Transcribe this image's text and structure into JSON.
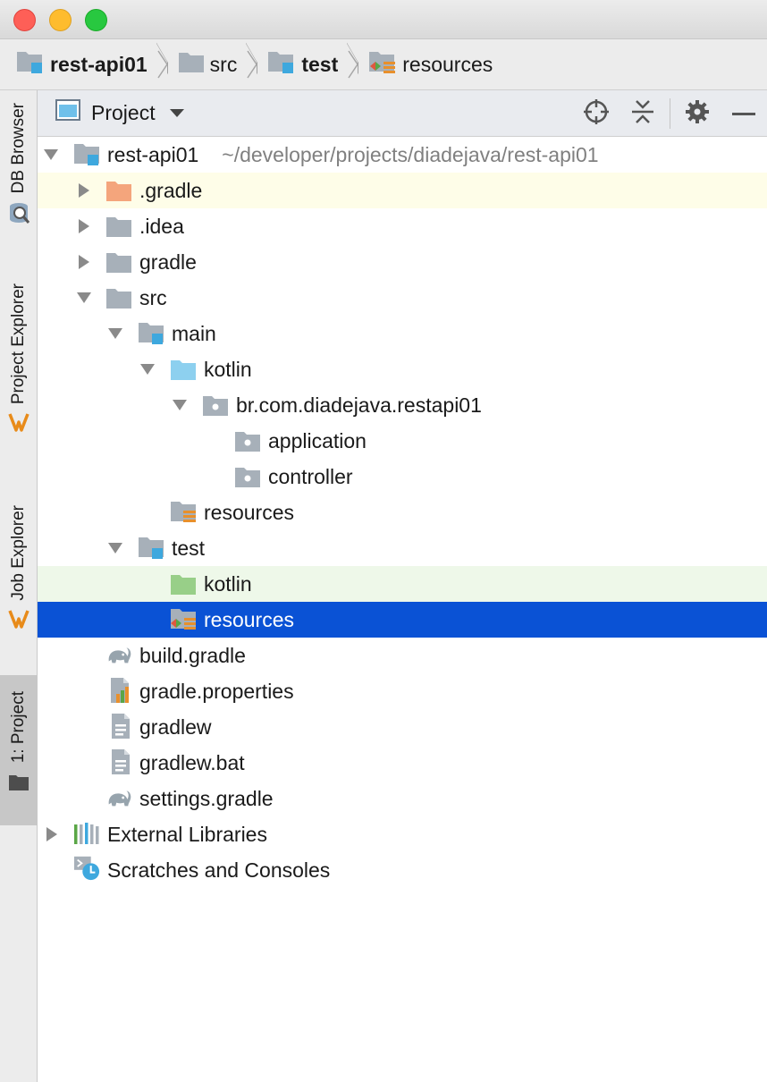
{
  "breadcrumb": {
    "items": [
      {
        "label": "rest-api01",
        "bold": true
      },
      {
        "label": "src",
        "bold": false
      },
      {
        "label": "test",
        "bold": true
      },
      {
        "label": "resources",
        "bold": false
      }
    ]
  },
  "left_strip": {
    "tabs": [
      {
        "label": "DB Browser"
      },
      {
        "label": "Project Explorer"
      },
      {
        "label": "Job Explorer"
      },
      {
        "label": "1: Project",
        "active": true
      }
    ]
  },
  "tool_window": {
    "title": "Project",
    "actions": [
      "locate-icon",
      "collapse-all-icon",
      "gear-icon",
      "minimize-icon"
    ]
  },
  "tree": {
    "root_label": "rest-api01",
    "root_path": "~/developer/projects/diadejava/rest-api01",
    "items": {
      "gradle_dot": ".gradle",
      "idea": ".idea",
      "gradle": "gradle",
      "src": "src",
      "main": "main",
      "kotlin_main": "kotlin",
      "package": "br.com.diadejava.restapi01",
      "application": "application",
      "controller": "controller",
      "resources_main": "resources",
      "test": "test",
      "kotlin_test": "kotlin",
      "resources_test": "resources",
      "build_gradle": "build.gradle",
      "gradle_properties": "gradle.properties",
      "gradlew": "gradlew",
      "gradlew_bat": "gradlew.bat",
      "settings_gradle": "settings.gradle",
      "external_libraries": "External Libraries",
      "scratches": "Scratches and Consoles"
    }
  },
  "colors": {
    "selection": "#0a52d5",
    "gradle_highlight": "#fefde8",
    "test_highlight": "#eef8e9",
    "folder_gray": "#a7b0b9",
    "folder_orange": "#f4a57c",
    "folder_blue": "#8dd0ef",
    "folder_green": "#98cf88",
    "module_blue": "#3ea8de"
  }
}
